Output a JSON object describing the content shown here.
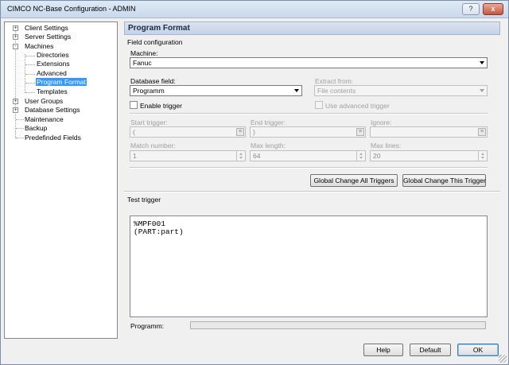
{
  "window": {
    "title": "CIMCO NC-Base Configuration - ADMIN",
    "help_glyph": "?",
    "close_glyph": "x"
  },
  "tree": {
    "items": [
      {
        "label": "Client Settings",
        "expander": "+"
      },
      {
        "label": "Server Settings",
        "expander": "+"
      },
      {
        "label": "Machines",
        "expander": "-"
      },
      {
        "label": "Directories"
      },
      {
        "label": "Extensions"
      },
      {
        "label": "Advanced"
      },
      {
        "label": "Program Format",
        "selected": true
      },
      {
        "label": "Templates"
      },
      {
        "label": "User Groups",
        "expander": "+"
      },
      {
        "label": "Database Settings",
        "expander": "+"
      },
      {
        "label": "Maintenance"
      },
      {
        "label": "Backup"
      },
      {
        "label": "Predefinded Fields"
      }
    ]
  },
  "main": {
    "header": "Program Format",
    "field_configuration": "Field configuration",
    "machine_label": "Machine:",
    "machine_value": "Fanuc",
    "database_field_label": "Database field:",
    "database_field_value": "Programm",
    "extract_from_label": "Extract from:",
    "extract_from_value": "File contents",
    "enable_trigger_label": "Enable trigger",
    "use_advanced_trigger_label": "Use advanced trigger",
    "start_trigger_label": "Start trigger:",
    "start_trigger_value": "(",
    "end_trigger_label": "End trigger:",
    "end_trigger_value": ")",
    "ignore_label": "Ignore:",
    "ignore_value": "",
    "match_number_label": "Match number:",
    "match_number_value": "1",
    "max_length_label": "Max length:",
    "max_length_value": "64",
    "max_lines_label": "Max lines:",
    "max_lines_value": "20",
    "global_change_all_label": "Global Change All Triggers",
    "global_change_this_label": "Global Change This Trigger",
    "test_trigger_label": "Test trigger",
    "test_text": "%MPF001\n(PART:part)",
    "programm_label": "Programm:"
  },
  "footer": {
    "help_label": "Help",
    "default_label": "Default",
    "ok_label": "OK"
  },
  "colors": {
    "selection": "#3399ff",
    "header_bg": "#c4d3e6",
    "close_button": "#c8553e"
  }
}
